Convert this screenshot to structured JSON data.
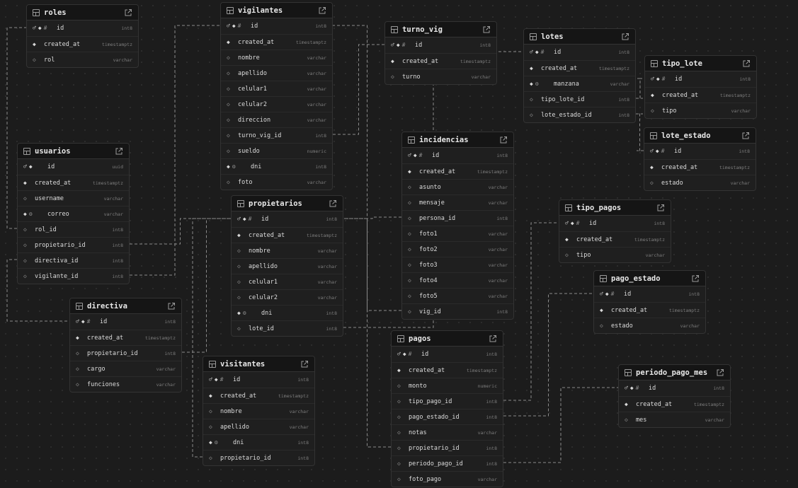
{
  "colors": {
    "background": "#1c1c1c",
    "table_bg": "#1f1f1f",
    "header_bg": "#151515",
    "border": "#333333",
    "edge": "#8a8a8a"
  },
  "tables": [
    {
      "id": "roles",
      "name": "roles",
      "columns": [
        {
          "name": "id",
          "type": "int8",
          "flags": [
            "fk",
            "pk",
            "hash"
          ]
        },
        {
          "name": "created_at",
          "type": "timestamptz",
          "flags": [
            "nn"
          ]
        },
        {
          "name": "rol",
          "type": "varchar",
          "flags": [
            "null"
          ]
        }
      ]
    },
    {
      "id": "vigilantes",
      "name": "vigilantes",
      "columns": [
        {
          "name": "id",
          "type": "int8",
          "flags": [
            "fk",
            "pk",
            "hash"
          ]
        },
        {
          "name": "created_at",
          "type": "timestamptz",
          "flags": [
            "nn"
          ]
        },
        {
          "name": "nombre",
          "type": "varchar",
          "flags": [
            "null"
          ]
        },
        {
          "name": "apellido",
          "type": "varchar",
          "flags": [
            "null"
          ]
        },
        {
          "name": "celular1",
          "type": "varchar",
          "flags": [
            "null"
          ]
        },
        {
          "name": "celular2",
          "type": "varchar",
          "flags": [
            "null"
          ]
        },
        {
          "name": "direccion",
          "type": "varchar",
          "flags": [
            "null"
          ]
        },
        {
          "name": "turno_vig_id",
          "type": "int8",
          "flags": [
            "null"
          ]
        },
        {
          "name": "sueldo",
          "type": "numeric",
          "flags": [
            "null"
          ]
        },
        {
          "name": "dni",
          "type": "int8",
          "flags": [
            "nn",
            "unique"
          ]
        },
        {
          "name": "foto",
          "type": "varchar",
          "flags": [
            "null"
          ]
        }
      ]
    },
    {
      "id": "turno_vig",
      "name": "turno_vig",
      "columns": [
        {
          "name": "id",
          "type": "int8",
          "flags": [
            "fk",
            "pk",
            "hash"
          ]
        },
        {
          "name": "created_at",
          "type": "timestamptz",
          "flags": [
            "nn"
          ]
        },
        {
          "name": "turno",
          "type": "varchar",
          "flags": [
            "null"
          ]
        }
      ]
    },
    {
      "id": "lotes",
      "name": "lotes",
      "columns": [
        {
          "name": "id",
          "type": "int8",
          "flags": [
            "fk",
            "pk",
            "hash"
          ]
        },
        {
          "name": "created_at",
          "type": "timestamptz",
          "flags": [
            "nn"
          ]
        },
        {
          "name": "manzana",
          "type": "varchar",
          "flags": [
            "nn",
            "unique"
          ]
        },
        {
          "name": "tipo_lote_id",
          "type": "int8",
          "flags": [
            "null"
          ]
        },
        {
          "name": "lote_estado_id",
          "type": "int8",
          "flags": [
            "null"
          ]
        }
      ]
    },
    {
      "id": "tipo_lote",
      "name": "tipo_lote",
      "columns": [
        {
          "name": "id",
          "type": "int8",
          "flags": [
            "fk",
            "pk",
            "hash"
          ]
        },
        {
          "name": "created_at",
          "type": "timestamptz",
          "flags": [
            "nn"
          ]
        },
        {
          "name": "tipo",
          "type": "varchar",
          "flags": [
            "null"
          ]
        }
      ]
    },
    {
      "id": "lote_estado",
      "name": "lote_estado",
      "columns": [
        {
          "name": "id",
          "type": "int8",
          "flags": [
            "fk",
            "pk",
            "hash"
          ]
        },
        {
          "name": "created_at",
          "type": "timestamptz",
          "flags": [
            "nn"
          ]
        },
        {
          "name": "estado",
          "type": "varchar",
          "flags": [
            "null"
          ]
        }
      ]
    },
    {
      "id": "usuarios",
      "name": "usuarios",
      "columns": [
        {
          "name": "id",
          "type": "uuid",
          "flags": [
            "fk",
            "pk"
          ]
        },
        {
          "name": "created_at",
          "type": "timestamptz",
          "flags": [
            "nn"
          ]
        },
        {
          "name": "username",
          "type": "varchar",
          "flags": [
            "null"
          ]
        },
        {
          "name": "correo",
          "type": "varchar",
          "flags": [
            "nn",
            "unique"
          ]
        },
        {
          "name": "rol_id",
          "type": "int8",
          "flags": [
            "null"
          ]
        },
        {
          "name": "propietario_id",
          "type": "int8",
          "flags": [
            "null"
          ]
        },
        {
          "name": "directiva_id",
          "type": "int8",
          "flags": [
            "null"
          ]
        },
        {
          "name": "vigilante_id",
          "type": "int8",
          "flags": [
            "null"
          ]
        }
      ]
    },
    {
      "id": "incidencias",
      "name": "incidencias",
      "columns": [
        {
          "name": "id",
          "type": "int8",
          "flags": [
            "fk",
            "pk",
            "hash"
          ]
        },
        {
          "name": "created_at",
          "type": "timestamptz",
          "flags": [
            "nn"
          ]
        },
        {
          "name": "asunto",
          "type": "varchar",
          "flags": [
            "null"
          ]
        },
        {
          "name": "mensaje",
          "type": "varchar",
          "flags": [
            "null"
          ]
        },
        {
          "name": "persona_id",
          "type": "int8",
          "flags": [
            "null"
          ]
        },
        {
          "name": "foto1",
          "type": "varchar",
          "flags": [
            "null"
          ]
        },
        {
          "name": "foto2",
          "type": "varchar",
          "flags": [
            "null"
          ]
        },
        {
          "name": "foto3",
          "type": "varchar",
          "flags": [
            "null"
          ]
        },
        {
          "name": "foto4",
          "type": "varchar",
          "flags": [
            "null"
          ]
        },
        {
          "name": "foto5",
          "type": "varchar",
          "flags": [
            "null"
          ]
        },
        {
          "name": "vig_id",
          "type": "int8",
          "flags": [
            "null"
          ]
        }
      ]
    },
    {
      "id": "propietarios",
      "name": "propietarios",
      "columns": [
        {
          "name": "id",
          "type": "int8",
          "flags": [
            "fk",
            "pk",
            "hash"
          ]
        },
        {
          "name": "created_at",
          "type": "timestamptz",
          "flags": [
            "nn"
          ]
        },
        {
          "name": "nombre",
          "type": "varchar",
          "flags": [
            "null"
          ]
        },
        {
          "name": "apellido",
          "type": "varchar",
          "flags": [
            "null"
          ]
        },
        {
          "name": "celular1",
          "type": "varchar",
          "flags": [
            "null"
          ]
        },
        {
          "name": "celular2",
          "type": "varchar",
          "flags": [
            "null"
          ]
        },
        {
          "name": "dni",
          "type": "int8",
          "flags": [
            "nn",
            "unique"
          ]
        },
        {
          "name": "lote_id",
          "type": "int8",
          "flags": [
            "null"
          ]
        }
      ]
    },
    {
      "id": "tipo_pagos",
      "name": "tipo_pagos",
      "columns": [
        {
          "name": "id",
          "type": "int8",
          "flags": [
            "fk",
            "pk",
            "hash"
          ]
        },
        {
          "name": "created_at",
          "type": "timestamptz",
          "flags": [
            "nn"
          ]
        },
        {
          "name": "tipo",
          "type": "varchar",
          "flags": [
            "null"
          ]
        }
      ]
    },
    {
      "id": "pago_estado",
      "name": "pago_estado",
      "columns": [
        {
          "name": "id",
          "type": "int8",
          "flags": [
            "fk",
            "pk",
            "hash"
          ]
        },
        {
          "name": "created_at",
          "type": "timestamptz",
          "flags": [
            "nn"
          ]
        },
        {
          "name": "estado",
          "type": "varchar",
          "flags": [
            "null"
          ]
        }
      ]
    },
    {
      "id": "directiva",
      "name": "directiva",
      "columns": [
        {
          "name": "id",
          "type": "int8",
          "flags": [
            "fk",
            "pk",
            "hash"
          ]
        },
        {
          "name": "created_at",
          "type": "timestamptz",
          "flags": [
            "nn"
          ]
        },
        {
          "name": "propietario_id",
          "type": "int8",
          "flags": [
            "null"
          ]
        },
        {
          "name": "cargo",
          "type": "varchar",
          "flags": [
            "null"
          ]
        },
        {
          "name": "funciones",
          "type": "varchar",
          "flags": [
            "null"
          ]
        }
      ]
    },
    {
      "id": "pagos",
      "name": "pagos",
      "columns": [
        {
          "name": "id",
          "type": "int8",
          "flags": [
            "fk",
            "pk",
            "hash"
          ]
        },
        {
          "name": "created_at",
          "type": "timestamptz",
          "flags": [
            "nn"
          ]
        },
        {
          "name": "monto",
          "type": "numeric",
          "flags": [
            "null"
          ]
        },
        {
          "name": "tipo_pago_id",
          "type": "int8",
          "flags": [
            "null"
          ]
        },
        {
          "name": "pago_estado_id",
          "type": "int8",
          "flags": [
            "null"
          ]
        },
        {
          "name": "notas",
          "type": "varchar",
          "flags": [
            "null"
          ]
        },
        {
          "name": "propietario_id",
          "type": "int8",
          "flags": [
            "null"
          ]
        },
        {
          "name": "periodo_pago_id",
          "type": "int8",
          "flags": [
            "null"
          ]
        },
        {
          "name": "foto_pago",
          "type": "varchar",
          "flags": [
            "null"
          ]
        }
      ]
    },
    {
      "id": "visitantes",
      "name": "visitantes",
      "columns": [
        {
          "name": "id",
          "type": "int8",
          "flags": [
            "fk",
            "pk",
            "hash"
          ]
        },
        {
          "name": "created_at",
          "type": "timestamptz",
          "flags": [
            "nn"
          ]
        },
        {
          "name": "nombre",
          "type": "varchar",
          "flags": [
            "null"
          ]
        },
        {
          "name": "apellido",
          "type": "varchar",
          "flags": [
            "null"
          ]
        },
        {
          "name": "dni",
          "type": "int8",
          "flags": [
            "nn",
            "unique"
          ]
        },
        {
          "name": "propietario_id",
          "type": "int8",
          "flags": [
            "null"
          ]
        }
      ]
    },
    {
      "id": "periodo_pago_mes",
      "name": "periodo_pago_mes",
      "columns": [
        {
          "name": "id",
          "type": "int8",
          "flags": [
            "fk",
            "pk",
            "hash"
          ]
        },
        {
          "name": "created_at",
          "type": "timestamptz",
          "flags": [
            "nn"
          ]
        },
        {
          "name": "mes",
          "type": "varchar",
          "flags": [
            "null"
          ]
        }
      ]
    }
  ],
  "relations": [
    {
      "from": "usuarios.rol_id",
      "to": "roles.id"
    },
    {
      "from": "usuarios.vigilante_id",
      "to": "vigilantes.id"
    },
    {
      "from": "usuarios.propietario_id",
      "to": "propietarios.id"
    },
    {
      "from": "usuarios.directiva_id",
      "to": "directiva.id"
    },
    {
      "from": "vigilantes.turno_vig_id",
      "to": "turno_vig.id"
    },
    {
      "from": "lotes.tipo_lote_id",
      "to": "tipo_lote.id"
    },
    {
      "from": "lotes.lote_estado_id",
      "to": "lote_estado.id"
    },
    {
      "from": "propietarios.lote_id",
      "to": "lotes.id"
    },
    {
      "from": "incidencias.vig_id",
      "to": "vigilantes.id"
    },
    {
      "from": "incidencias.persona_id",
      "to": "propietarios.id"
    },
    {
      "from": "directiva.propietario_id",
      "to": "propietarios.id"
    },
    {
      "from": "visitantes.propietario_id",
      "to": "propietarios.id"
    },
    {
      "from": "pagos.tipo_pago_id",
      "to": "tipo_pagos.id"
    },
    {
      "from": "pagos.pago_estado_id",
      "to": "pago_estado.id"
    },
    {
      "from": "pagos.propietario_id",
      "to": "propietarios.id"
    },
    {
      "from": "pagos.periodo_pago_id",
      "to": "periodo_pago_mes.id"
    }
  ]
}
